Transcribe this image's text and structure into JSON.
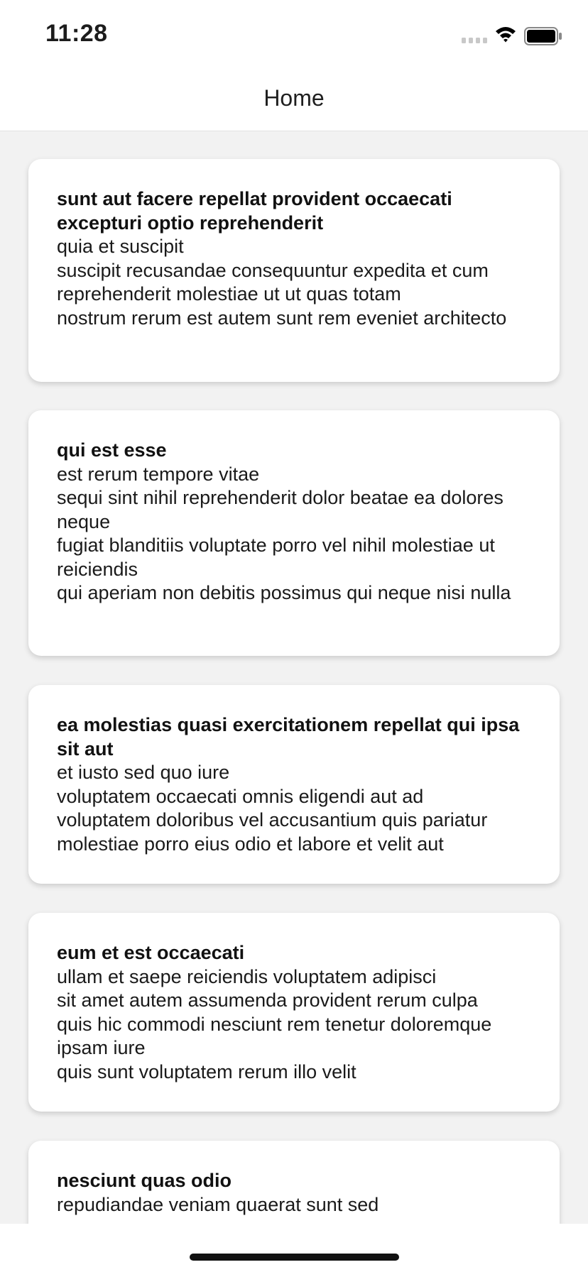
{
  "status_bar": {
    "time": "11:28",
    "icons": [
      "signal-icon",
      "wifi-icon",
      "battery-icon"
    ]
  },
  "nav": {
    "title": "Home"
  },
  "posts": [
    {
      "title": "sunt aut facere repellat provident occaecati excepturi optio reprehenderit",
      "body": "quia et suscipit\nsuscipit recusandae consequuntur expedita et cum reprehenderit molestiae ut ut quas totam\nnostrum rerum est autem sunt rem eveniet architecto"
    },
    {
      "title": "qui est esse",
      "body": "est rerum tempore vitae\nsequi sint nihil reprehenderit dolor beatae ea dolores neque\nfugiat blanditiis voluptate porro vel nihil molestiae ut reiciendis\nqui aperiam non debitis possimus qui neque nisi nulla"
    },
    {
      "title": "ea molestias quasi exercitationem repellat qui ipsa sit aut",
      "body": "et iusto sed quo iure\nvoluptatem occaecati omnis eligendi aut ad\nvoluptatem doloribus vel accusantium quis pariatur\nmolestiae porro eius odio et labore et velit aut"
    },
    {
      "title": "eum et est occaecati",
      "body": "ullam et saepe reiciendis voluptatem adipisci\nsit amet autem assumenda provident rerum culpa\nquis hic commodi nesciunt rem tenetur doloremque ipsam iure\nquis sunt voluptatem rerum illo velit"
    },
    {
      "title": "nesciunt quas odio",
      "body": "repudiandae veniam quaerat sunt sed"
    }
  ],
  "colors": {
    "background": "#f2f2f2",
    "card": "#ffffff",
    "text": "#111111"
  }
}
